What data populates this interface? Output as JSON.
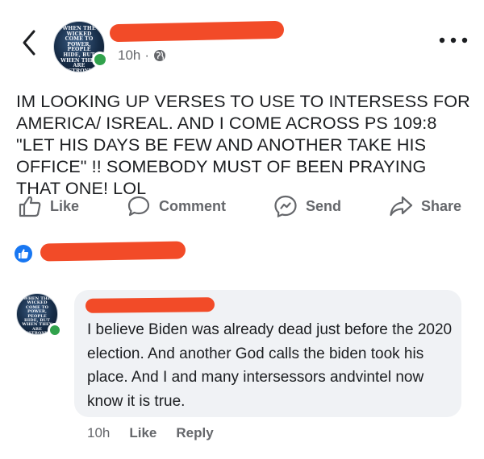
{
  "header": {
    "back_icon": "chevron-left-icon",
    "more_icon": "more-dots-icon",
    "timestamp": "10h",
    "separator": "·",
    "audience_icon": "globe-icon"
  },
  "avatar": {
    "text": "When the wicked come to power, people hide, but when they are destroyed, the righteous flourish PROVERBS"
  },
  "post": {
    "text": "IM LOOKING UP VERSES TO USE TO INTERSESS FOR AMERICA/ ISREAL. AND I COME ACROSS PS 109:8 \"LET HIS DAYS BE FEW AND ANOTHER TAKE HIS OFFICE\" !! SOMEBODY MUST OF BEEN PRAYING THAT ONE! LOL"
  },
  "actions": {
    "like": "Like",
    "comment": "Comment",
    "send": "Send",
    "share": "Share"
  },
  "comment": {
    "text": "I believe Biden was already dead just before the 2020 election. And  another God calls the biden took his place. And I and many intersessors andvintel now know it is true.",
    "time": "10h",
    "like": "Like",
    "reply": "Reply"
  },
  "colors": {
    "redaction": "#f24b28",
    "accent": "#1877f2",
    "online": "#31a24c",
    "muted_text": "#65676b",
    "bubble": "#f0f2f5"
  }
}
